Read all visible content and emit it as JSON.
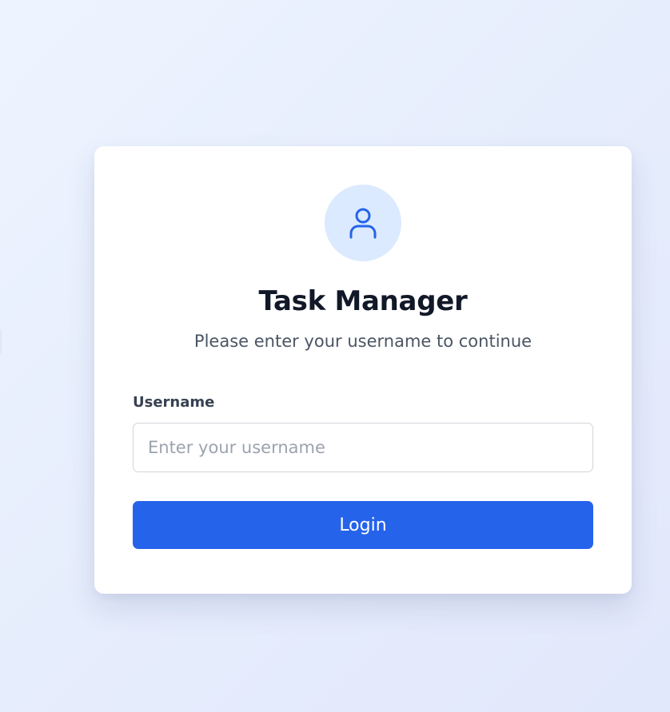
{
  "login": {
    "icon": "user-icon",
    "title": "Task Manager",
    "subtitle": "Please enter your username to continue",
    "username_label": "Username",
    "username_placeholder": "Enter your username",
    "username_value": "",
    "login_label": "Login"
  },
  "colors": {
    "accent": "#2563eb",
    "avatar_bg": "#dbeafe",
    "title_text": "#111827",
    "subtitle_text": "#4b5563",
    "page_bg": "#e8eefc"
  }
}
